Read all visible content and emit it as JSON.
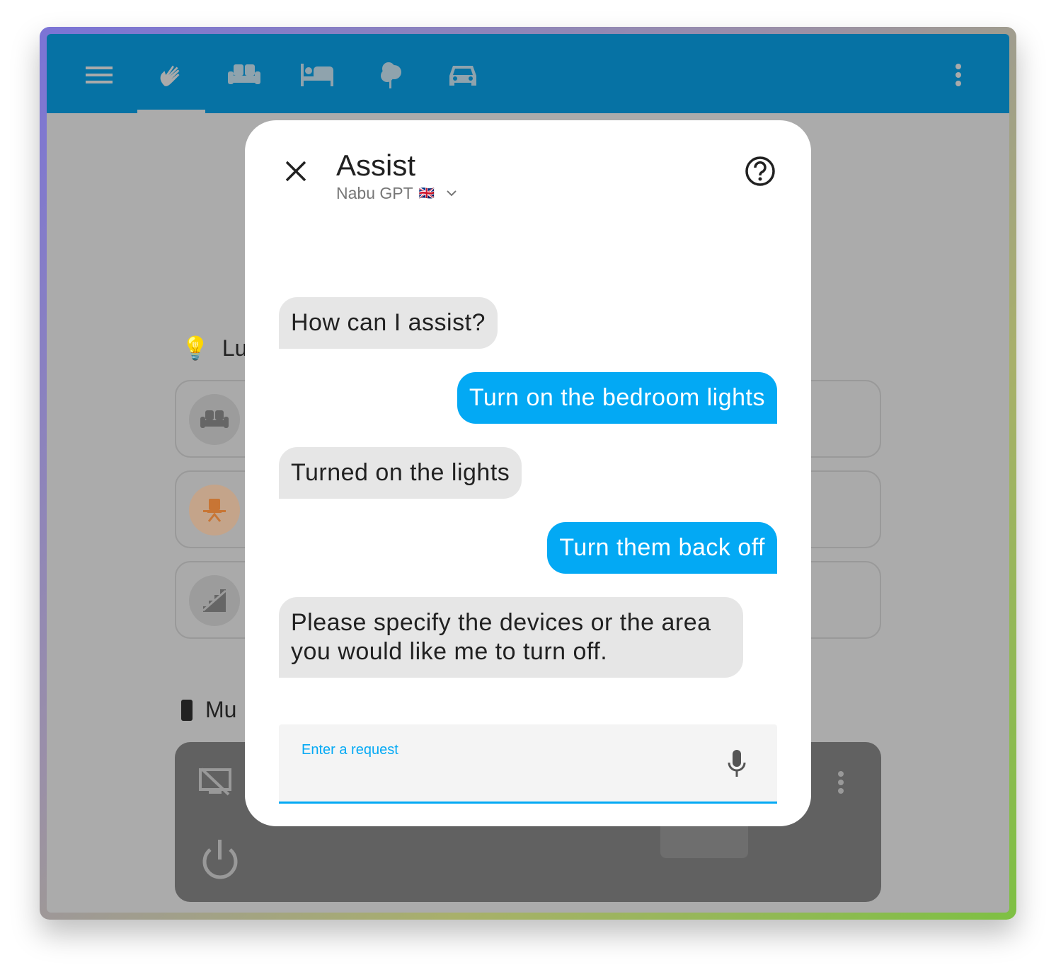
{
  "header": {
    "tabs": [
      {
        "icon": "hand-wave-icon",
        "active": true
      },
      {
        "icon": "sofa-icon"
      },
      {
        "icon": "bed-icon"
      },
      {
        "icon": "tree-icon"
      },
      {
        "icon": "car-icon"
      }
    ]
  },
  "background": {
    "sections": [
      {
        "label": "Lu",
        "icon": "lightbulb-icon"
      },
      {
        "label": "Mu",
        "icon": "remote-icon"
      }
    ]
  },
  "dialog": {
    "title": "Assist",
    "agent": "Nabu GPT",
    "flag": "🇬🇧",
    "messages": [
      {
        "from": "assistant",
        "text": "How can I assist?"
      },
      {
        "from": "user",
        "text": "Turn on the bedroom lights"
      },
      {
        "from": "assistant",
        "text": "Turned on the lights"
      },
      {
        "from": "user",
        "text": "Turn them back off"
      },
      {
        "from": "assistant",
        "text": "Please specify the devices or the area you would like me to turn off."
      }
    ],
    "input_label": "Enter a request",
    "input_value": ""
  },
  "colors": {
    "header": "#0672a4",
    "accent": "#03a9f4"
  }
}
